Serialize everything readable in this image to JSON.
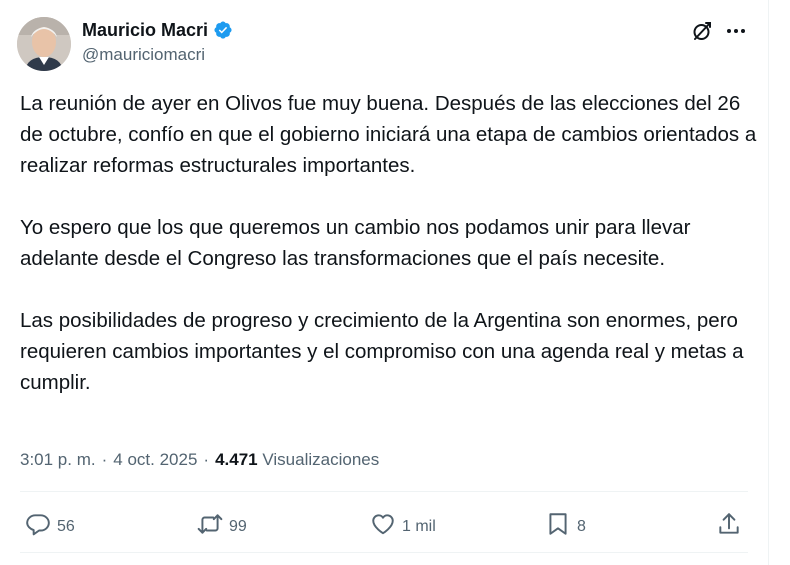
{
  "author": {
    "display_name": "Mauricio Macri",
    "handle": "@mauriciomacri",
    "verified": true,
    "verified_color": "#1d9bf0"
  },
  "tweet": {
    "paragraphs": [
      "La reunión de ayer en Olivos fue muy buena. Después de las elecciones del 26 de octubre, confío en que el gobierno iniciará una etapa de cambios orientados a realizar reformas estructurales importantes.",
      "Yo espero que los que queremos un cambio nos podamos unir para llevar adelante desde el Congreso las transformaciones que el país necesite.",
      "Las posibilidades de progreso y crecimiento de la Argentina son enormes, pero requieren cambios importantes y el compromiso con una agenda real y metas a cumplir."
    ]
  },
  "meta": {
    "time": "3:01 p. m.",
    "date": "4 oct. 2025",
    "separator": "·",
    "views_count": "4.471",
    "views_label": "Visualizaciones"
  },
  "actions": {
    "replies": "56",
    "reposts": "99",
    "likes": "1 mil",
    "bookmarks": "8"
  },
  "icons": [
    "grok-icon",
    "more-icon",
    "verified-badge-icon",
    "reply-icon",
    "repost-icon",
    "like-icon",
    "bookmark-icon",
    "share-icon"
  ],
  "colors": {
    "text": "#0f1419",
    "secondary": "#536471",
    "divider": "#eff3f4"
  }
}
